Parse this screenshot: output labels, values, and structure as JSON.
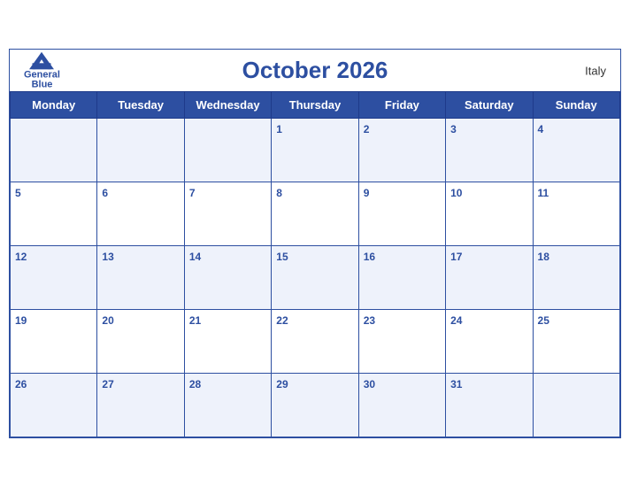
{
  "header": {
    "logo": {
      "general": "General",
      "blue": "Blue"
    },
    "title": "October 2026",
    "country": "Italy"
  },
  "weekdays": [
    "Monday",
    "Tuesday",
    "Wednesday",
    "Thursday",
    "Friday",
    "Saturday",
    "Sunday"
  ],
  "weeks": [
    [
      null,
      null,
      null,
      1,
      2,
      3,
      4
    ],
    [
      5,
      6,
      7,
      8,
      9,
      10,
      11
    ],
    [
      12,
      13,
      14,
      15,
      16,
      17,
      18
    ],
    [
      19,
      20,
      21,
      22,
      23,
      24,
      25
    ],
    [
      26,
      27,
      28,
      29,
      30,
      31,
      null
    ]
  ]
}
